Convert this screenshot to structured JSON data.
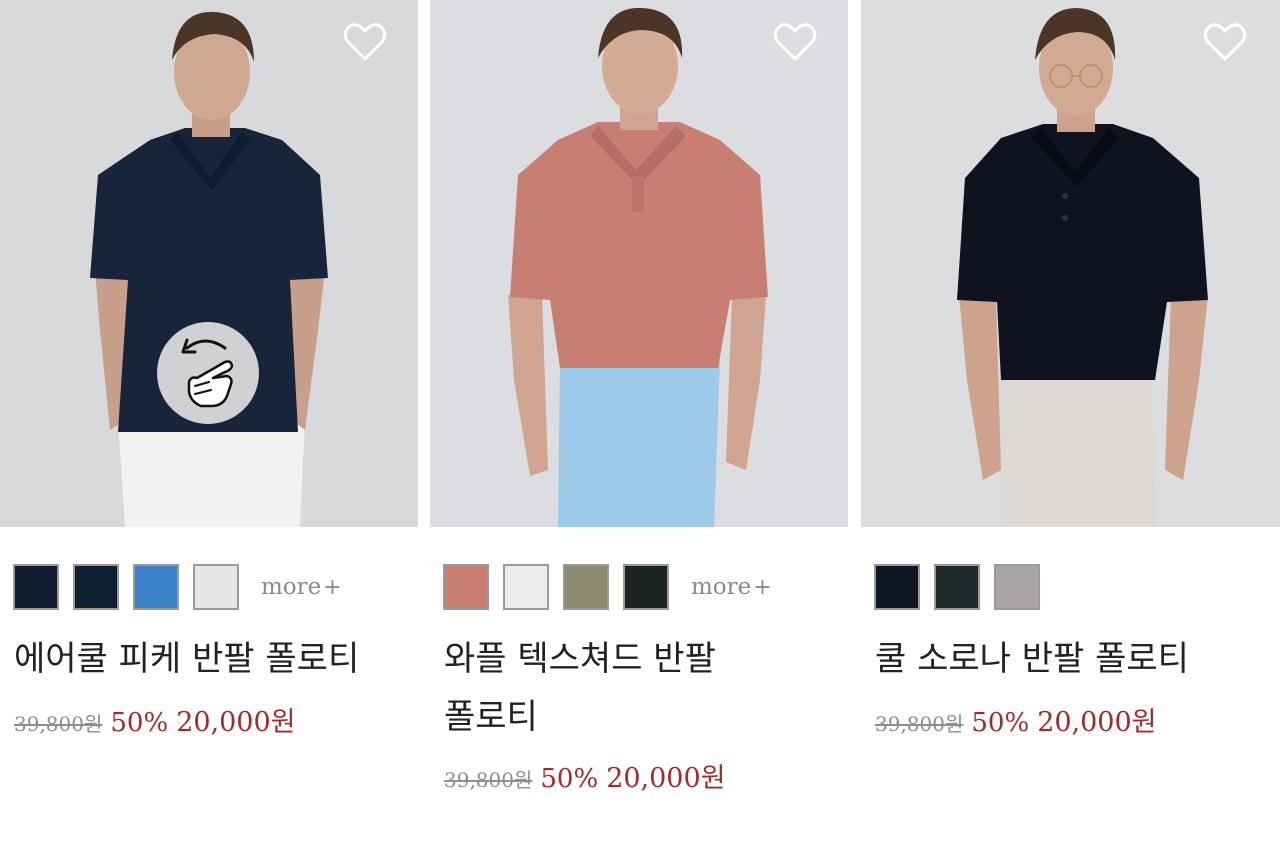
{
  "products": [
    {
      "name": "에어쿨 피케 반팔 폴로티",
      "name_line2": "",
      "original_price": "39,800원",
      "discount": "50%",
      "sale_price": "20,000원",
      "more_label": "more",
      "swatches": [
        "#0f1b2c",
        "#0c2030",
        "#3b82c8",
        "#e6e6e8"
      ],
      "shirt_color": "#17243a",
      "pants_color": "#f2f2f0"
    },
    {
      "name": "와플 텍스쳐드 반팔",
      "name_line2": "폴로티",
      "original_price": "39,800원",
      "discount": "50%",
      "sale_price": "20,000원",
      "more_label": "more",
      "swatches": [
        "#c97e74",
        "#ececec",
        "#8b8a70",
        "#1a2420"
      ],
      "shirt_color": "#c97e74",
      "pants_color": "#9ccae8"
    },
    {
      "name": "쿨 소로나 반팔 폴로티",
      "name_line2": "",
      "original_price": "39,800원",
      "discount": "50%",
      "sale_price": "20,000원",
      "more_label": "",
      "swatches": [
        "#0e1626",
        "#1f2a2c",
        "#a9a5a4"
      ],
      "shirt_color": "#0f1320",
      "pants_color": "#dcd9d5"
    }
  ],
  "icons": {
    "heart": "heart-outline-icon",
    "gesture": "swipe-gesture-icon",
    "plus": "plus-icon"
  }
}
